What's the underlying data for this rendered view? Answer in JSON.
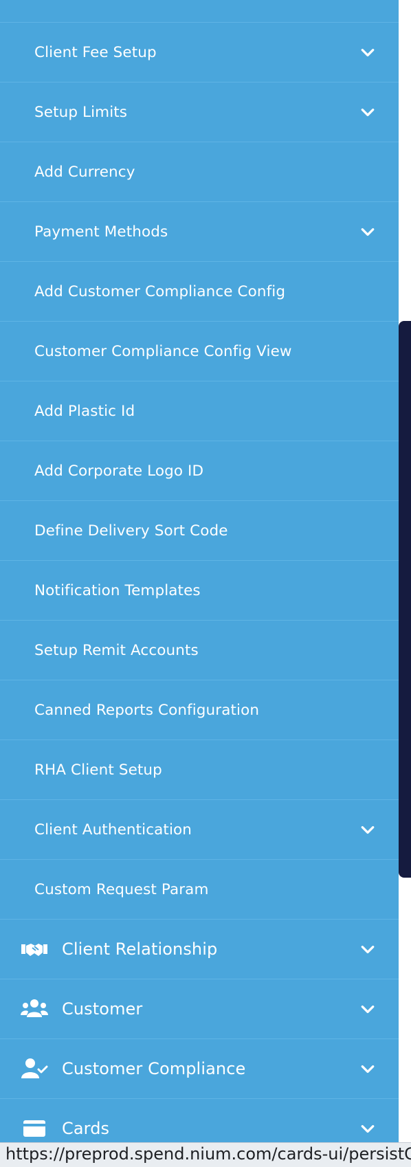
{
  "sidebar": {
    "submenu": [
      {
        "label": "Client Fee Setup",
        "expandable": true
      },
      {
        "label": "Setup Limits",
        "expandable": true
      },
      {
        "label": "Add Currency",
        "expandable": false
      },
      {
        "label": "Payment Methods",
        "expandable": true
      },
      {
        "label": "Add Customer Compliance Config",
        "expandable": false
      },
      {
        "label": "Customer Compliance Config View",
        "expandable": false
      },
      {
        "label": "Add Plastic Id",
        "expandable": false
      },
      {
        "label": "Add Corporate Logo ID",
        "expandable": false
      },
      {
        "label": "Define Delivery Sort Code",
        "expandable": false
      },
      {
        "label": "Notification Templates",
        "expandable": false
      },
      {
        "label": "Setup Remit Accounts",
        "expandable": false
      },
      {
        "label": "Canned Reports Configuration",
        "expandable": false
      },
      {
        "label": "RHA Client Setup",
        "expandable": false
      },
      {
        "label": "Client Authentication",
        "expandable": true
      },
      {
        "label": "Custom Request Param",
        "expandable": false
      }
    ],
    "top_level": [
      {
        "label": "Client Relationship",
        "icon": "handshake-icon"
      },
      {
        "label": "Customer",
        "icon": "users-icon"
      },
      {
        "label": "Customer Compliance",
        "icon": "user-check-icon"
      },
      {
        "label": "Cards",
        "icon": "credit-card-icon"
      }
    ]
  },
  "status_bar": {
    "url": "https://preprod.spend.nium.com/cards-ui/persistClie"
  },
  "colors": {
    "sidebar_bg": "#4aa6dc",
    "divider": "#5fb4e5",
    "text": "#ffffff",
    "scroll_thumb": "#151b3f"
  }
}
